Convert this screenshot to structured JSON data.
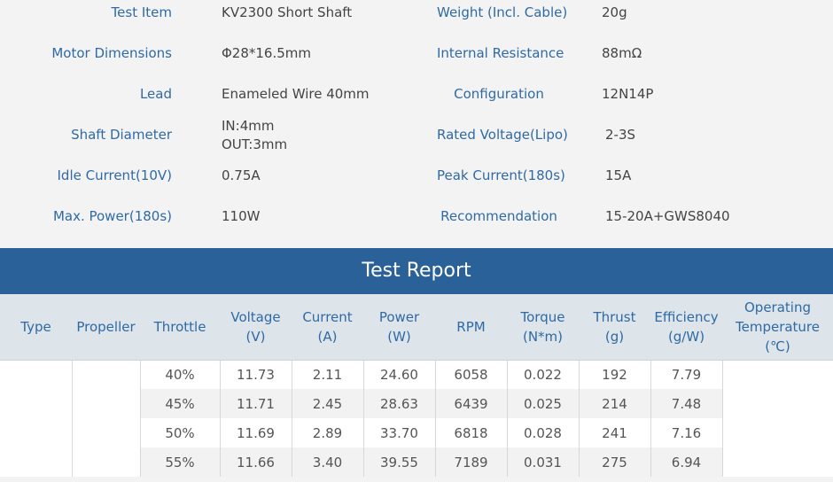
{
  "specs": {
    "rows": [
      {
        "l_label": "Test Item",
        "l_value": "KV2300 Short Shaft",
        "r_label": "Weight (Incl. Cable)",
        "r_value": "20g"
      },
      {
        "l_label": "Motor Dimensions",
        "l_value": "Φ28*16.5mm",
        "r_label": "Internal Resistance",
        "r_value": "88mΩ"
      },
      {
        "l_label": "Lead",
        "l_value": "Enameled Wire 40mm",
        "r_label": "Configuration",
        "r_value": "12N14P"
      },
      {
        "l_label": "Shaft Diameter",
        "l_value": "IN:4mm",
        "l_value2": "OUT:3mm",
        "r_label": "Rated Voltage(Lipo)",
        "r_value": "2-3S"
      },
      {
        "l_label": "Idle Current(10V)",
        "l_value": "0.75A",
        "r_label": "Peak Current(180s)",
        "r_value": "15A"
      },
      {
        "l_label": "Max. Power(180s)",
        "l_value": "110W",
        "r_label": "Recommendation",
        "r_value": "15-20A+GWS8040"
      }
    ]
  },
  "report": {
    "title": "Test Report",
    "headers": [
      {
        "line1": "Type",
        "line2": "",
        "line3": ""
      },
      {
        "line1": "Propeller",
        "line2": "",
        "line3": ""
      },
      {
        "line1": "Throttle",
        "line2": "",
        "line3": ""
      },
      {
        "line1": "Voltage",
        "line2": "(V)",
        "line3": ""
      },
      {
        "line1": "Current",
        "line2": "(A)",
        "line3": ""
      },
      {
        "line1": "Power",
        "line2": "(W)",
        "line3": ""
      },
      {
        "line1": "RPM",
        "line2": "",
        "line3": ""
      },
      {
        "line1": "Torque",
        "line2": "(N*m)",
        "line3": ""
      },
      {
        "line1": "Thrust",
        "line2": "(g)",
        "line3": ""
      },
      {
        "line1": "Efficiency",
        "line2": "(g/W)",
        "line3": ""
      },
      {
        "line1": "Operating",
        "line2": "Temperature",
        "line3": "(℃)"
      }
    ],
    "rows": [
      [
        "40%",
        "11.73",
        "2.11",
        "24.60",
        "6058",
        "0.022",
        "192",
        "7.79"
      ],
      [
        "45%",
        "11.71",
        "2.45",
        "28.63",
        "6439",
        "0.025",
        "214",
        "7.48"
      ],
      [
        "50%",
        "11.69",
        "2.89",
        "33.70",
        "6818",
        "0.028",
        "241",
        "7.16"
      ],
      [
        "55%",
        "11.66",
        "3.40",
        "39.55",
        "7189",
        "0.031",
        "275",
        "6.94"
      ]
    ]
  }
}
